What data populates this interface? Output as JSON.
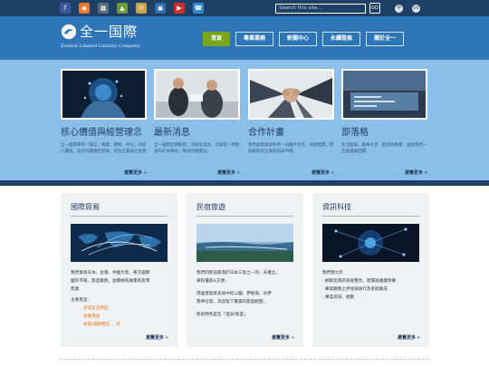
{
  "topbar": {
    "social_icons": [
      "facebook-icon",
      "rss-icon",
      "grid-icon",
      "image-icon",
      "mail-icon",
      "bookmark-icon",
      "video-icon",
      "phone-icon"
    ],
    "search_placeholder": "Search this site...",
    "go_label": "GO",
    "lang_cn": "中",
    "lang_en": "EN"
  },
  "header": {
    "logo_cn": "全一国際",
    "logo_en": "Zentick Limited Liability Company",
    "nav": [
      "首頁",
      "專業業務",
      "新聞中心",
      "永續發展",
      "關於全一"
    ]
  },
  "features": [
    {
      "title": "核心價值與經營理念",
      "desc": "全一國際秉持「誠信、專業、積極、共任」的核心價值，追求持續穩定發展，創造企業與社會雙贏。",
      "more": "瀏覽更多 »"
    },
    {
      "title": "最新消息",
      "desc": "全一國際近期動態，活動及消息，均會第一時間發布於本網站，敬請持續關注。",
      "more": "瀏覽更多 »"
    },
    {
      "title": "合作計畫",
      "desc": "我們誠摯邀請各界一同攜手合作，共創雙贏，開創嶄新的企業格局與市場。",
      "more": "瀏覽更多 »"
    },
    {
      "title": "部落格",
      "desc": "生活點滴、趣事分享，歡迎來看看，並給我們一些建議與回饋。",
      "more": "瀏覽更多 »"
    }
  ],
  "cards": [
    {
      "title": "國際貿易",
      "body_lines": [
        "我們貿易日本、台灣、中國大陸，東方國際",
        "國外市場，旅遊業務，並積極拓展電商及零",
        "售業"
      ],
      "products_label": "主要產品：",
      "products": [
        "日常生活用品",
        "保養用品",
        "休閒/運動用品 ... 等"
      ],
      "more": "瀏覽更多 »"
    },
    {
      "title": "民宿旅遊",
      "body_lines": [
        "我們的民宿座落於日本三島之一的：天橋立，",
        "車程優美&方便。",
        "",
        "周邊景點眾多如中松公園、伊根灣、天伊",
        "勢神社等，為您留下寶貴的旅遊經歷。",
        "",
        "民宿特色是在「溫泉/和室」"
      ],
      "more": "瀏覽更多 »"
    },
    {
      "title": "資訊科技",
      "body_lines": [
        "我們致力於",
        "· 網路及資訊系統整合，建置與維護架構",
        "· 專案服務之評估與執行及系統集成",
        "· 專案諮詢，規劃"
      ],
      "more": "瀏覽更多 »"
    }
  ]
}
